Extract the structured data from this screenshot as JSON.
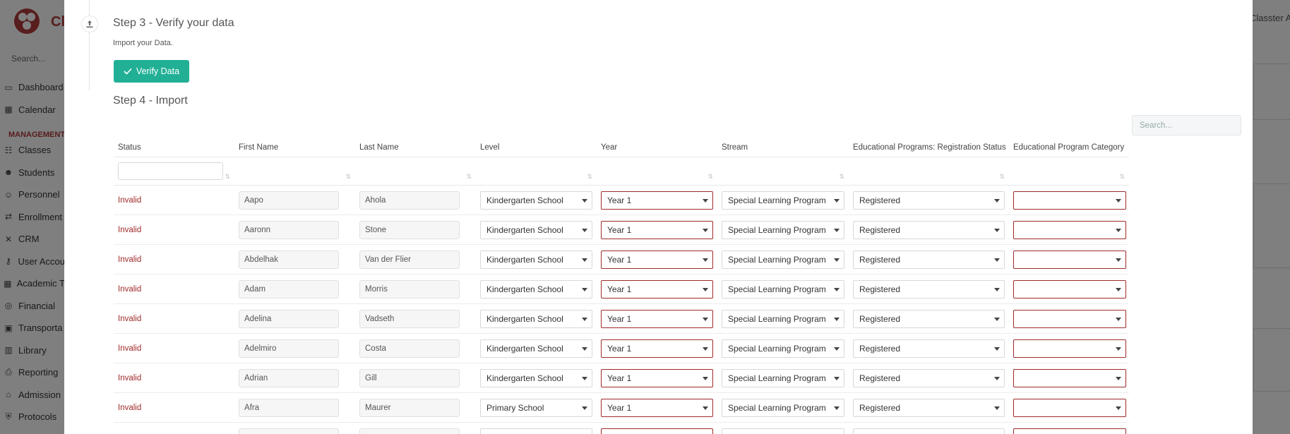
{
  "background": {
    "brand": "Cl",
    "search_label": "Search...",
    "nav": [
      {
        "icon": "laptop-icon",
        "label": "Dashboard"
      },
      {
        "icon": "calendar-icon",
        "label": "Calendar"
      },
      {
        "section": "MANAGEMENT"
      },
      {
        "icon": "classes-icon",
        "label": "Classes"
      },
      {
        "icon": "students-icon",
        "label": "Students"
      },
      {
        "icon": "personnel-icon",
        "label": "Personnel"
      },
      {
        "icon": "enrollment-icon",
        "label": "Enrollment"
      },
      {
        "icon": "crm-icon",
        "label": "CRM"
      },
      {
        "icon": "key-icon",
        "label": "User Accou"
      },
      {
        "icon": "grid-icon",
        "label": "Academic T"
      },
      {
        "icon": "coins-icon",
        "label": "Financial"
      },
      {
        "icon": "bus-icon",
        "label": "Transporta"
      },
      {
        "icon": "books-icon",
        "label": "Library"
      },
      {
        "icon": "print-icon",
        "label": "Reporting"
      },
      {
        "icon": "bank-icon",
        "label": "Admission"
      },
      {
        "icon": "shield-icon",
        "label": "Protocols"
      }
    ],
    "right_text": "Classter A"
  },
  "modal": {
    "step3": {
      "title": "Step 3 - Verify your data",
      "subtitle": "Import your Data.",
      "verify_button": "Verify Data"
    },
    "step4": {
      "title": "Step 4 - Import"
    },
    "search_placeholder": "Search...",
    "table": {
      "columns": [
        "Status",
        "First Name",
        "Last Name",
        "Level",
        "Year",
        "Stream",
        "Educational Programs: Registration Status",
        "Educational Program Category"
      ],
      "rows": [
        {
          "status": "Invalid",
          "first": "Aapo",
          "last": "Ahola",
          "level": "Kindergarten School",
          "year": "Year 1",
          "stream": "Special Learning Program",
          "reg_status": "Registered",
          "category": ""
        },
        {
          "status": "Invalid",
          "first": "Aaronn",
          "last": "Stone",
          "level": "Kindergarten School",
          "year": "Year 1",
          "stream": "Special Learning Program",
          "reg_status": "Registered",
          "category": ""
        },
        {
          "status": "Invalid",
          "first": "Abdelhak",
          "last": "Van der Flier",
          "level": "Kindergarten School",
          "year": "Year 1",
          "stream": "Special Learning Program",
          "reg_status": "Registered",
          "category": ""
        },
        {
          "status": "Invalid",
          "first": "Adam",
          "last": "Morris",
          "level": "Kindergarten School",
          "year": "Year 1",
          "stream": "Special Learning Program",
          "reg_status": "Registered",
          "category": ""
        },
        {
          "status": "Invalid",
          "first": "Adelina",
          "last": "Vadseth",
          "level": "Kindergarten School",
          "year": "Year 1",
          "stream": "Special Learning Program",
          "reg_status": "Registered",
          "category": ""
        },
        {
          "status": "Invalid",
          "first": "Adelmiro",
          "last": "Costa",
          "level": "Kindergarten School",
          "year": "Year 1",
          "stream": "Special Learning Program",
          "reg_status": "Registered",
          "category": ""
        },
        {
          "status": "Invalid",
          "first": "Adrian",
          "last": "Gill",
          "level": "Kindergarten School",
          "year": "Year 1",
          "stream": "Special Learning Program",
          "reg_status": "Registered",
          "category": ""
        },
        {
          "status": "Invalid",
          "first": "Afra",
          "last": "Maurer",
          "level": "Primary School",
          "year": "Year 1",
          "stream": "Special Learning Program",
          "reg_status": "Registered",
          "category": ""
        },
        {
          "status": "",
          "first": "",
          "last": "",
          "level": "",
          "year": "",
          "stream": "",
          "reg_status": "",
          "category": ""
        }
      ]
    }
  },
  "colors": {
    "accent": "#21b096",
    "invalid": "#a02a2a",
    "error_border": "#9e2a2a",
    "brand": "#b03a3a"
  }
}
